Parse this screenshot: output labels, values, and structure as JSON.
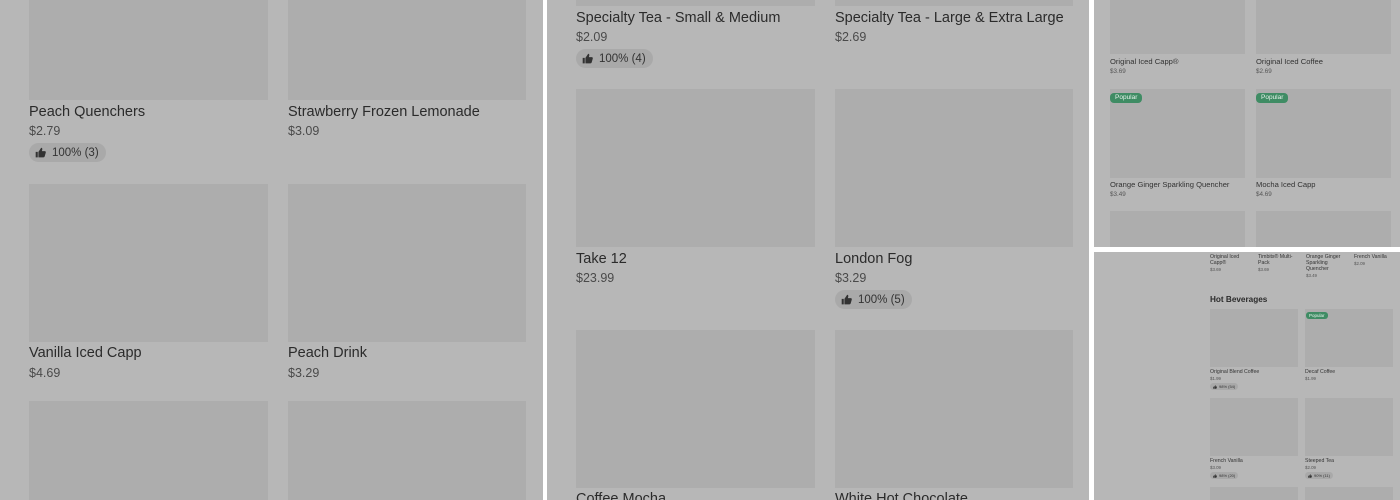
{
  "panel1": {
    "items": [
      {
        "name": "Peach Quenchers",
        "price": "$2.79",
        "rating": "100% (3)"
      },
      {
        "name": "Strawberry Frozen Lemonade",
        "price": "$3.09"
      },
      {
        "name": "Vanilla Iced Capp",
        "price": "$4.69"
      },
      {
        "name": "Peach Drink",
        "price": "$3.29"
      }
    ]
  },
  "panel2": {
    "items": [
      {
        "name": "Specialty Tea - Small & Medium",
        "price": "$2.09",
        "rating": "100% (4)"
      },
      {
        "name": "Specialty Tea - Large & Extra Large",
        "price": "$2.69"
      },
      {
        "name": "Take 12",
        "price": "$23.99"
      },
      {
        "name": "London Fog",
        "price": "$3.29",
        "rating": "100% (5)"
      },
      {
        "name": "Coffee Mocha"
      },
      {
        "name": "White Hot Chocolate"
      }
    ]
  },
  "panel3": {
    "items": [
      {
        "name": "Original Iced Capp®",
        "price": "$3.69"
      },
      {
        "name": "Original Iced Coffee",
        "price": "$2.69"
      },
      {
        "name": "Orange Ginger Sparkling Quencher",
        "price": "$3.49",
        "badge": "Popular"
      },
      {
        "name": "Mocha Iced Capp",
        "price": "$4.69",
        "badge": "Popular"
      }
    ]
  },
  "panel4": {
    "top_items": [
      {
        "name": "Original Iced Capp®",
        "price": "$3.69"
      },
      {
        "name": "Timbits® Multi-Pack",
        "price": "$3.69"
      },
      {
        "name": "Orange Ginger Sparkling Quencher",
        "price": "$3.49"
      },
      {
        "name": "French Vanilla",
        "price": "$2.09"
      }
    ],
    "section_title": "Hot Beverages",
    "items": [
      {
        "name": "Original Blend Coffee",
        "price": "$1.99",
        "rating": "98% (54)"
      },
      {
        "name": "Decaf Coffee",
        "price": "$1.99",
        "badge": "Popular"
      },
      {
        "name": "French Vanilla",
        "price": "$3.09",
        "rating": "98% (20)"
      },
      {
        "name": "Steeped Tea",
        "price": "$2.09",
        "rating": "90% (11)"
      }
    ]
  },
  "colors": {
    "overlay": "#b7b7b7",
    "image_placeholder": "#adadad",
    "badge": "#3f8c64"
  },
  "icons": {
    "rating": "thumbs-up-icon"
  }
}
